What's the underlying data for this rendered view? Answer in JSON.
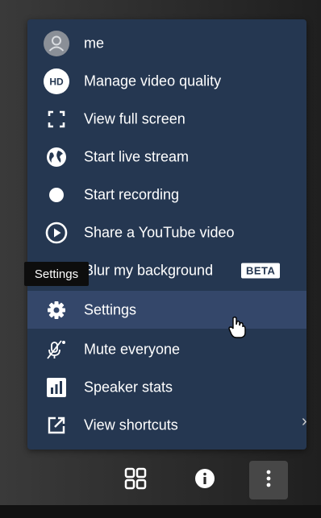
{
  "menu": {
    "items": [
      {
        "label": "me",
        "icon": "avatar-icon"
      },
      {
        "label": "Manage video quality",
        "icon": "hd-icon",
        "badge_text": "HD"
      },
      {
        "label": "View full screen",
        "icon": "fullscreen-icon"
      },
      {
        "label": "Start live stream",
        "icon": "globe-icon"
      },
      {
        "label": "Start recording",
        "icon": "record-icon"
      },
      {
        "label": "Share a YouTube video",
        "icon": "play-circle-icon"
      },
      {
        "label": "Blur my background",
        "icon": "blur-icon",
        "tag": "BETA"
      },
      {
        "label": "Settings",
        "icon": "gear-icon",
        "hovered": true
      },
      {
        "label": "Mute everyone",
        "icon": "mute-mic-icon"
      },
      {
        "label": "Speaker stats",
        "icon": "bar-chart-icon"
      },
      {
        "label": "View shortcuts",
        "icon": "external-link-icon"
      }
    ]
  },
  "tooltip": {
    "text": "Settings"
  },
  "toolbar": {
    "buttons": [
      {
        "icon": "tile-view-icon"
      },
      {
        "icon": "info-icon"
      },
      {
        "icon": "more-vertical-icon",
        "active": true
      }
    ]
  },
  "colors": {
    "menu_background": "#253751",
    "hover_background": "#34476a",
    "text": "#ffffff",
    "tooltip_background": "#0d0d0d"
  }
}
